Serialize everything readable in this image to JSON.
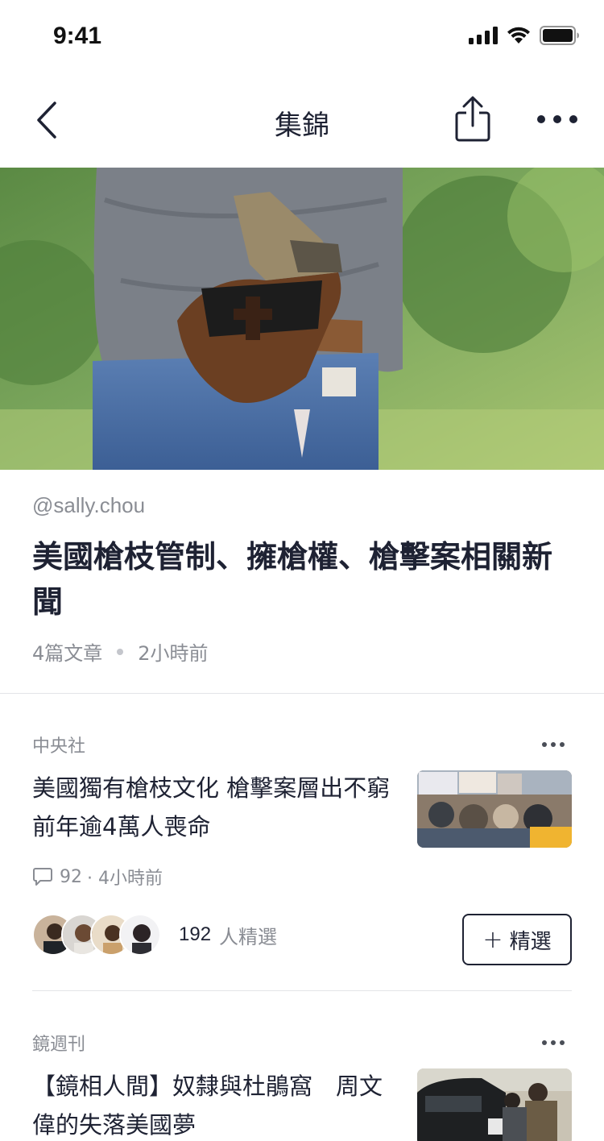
{
  "status": {
    "time": "9:41"
  },
  "nav": {
    "title": "集錦"
  },
  "collection": {
    "author": "@sally.chou",
    "title": "美國槍枝管制、擁槍權、槍擊案相關新聞",
    "article_count": "4篇文章",
    "updated": "2小時前"
  },
  "articles": [
    {
      "source": "中央社",
      "headline": "美國獨有槍枝文化 槍擊案層出不窮前年逾4萬人喪命",
      "comments": "92",
      "time": "· 4小時前",
      "curator_count": "192",
      "curator_label": "人精選",
      "pick_label": "精選"
    },
    {
      "source": "鏡週刊",
      "headline": "【鏡相人間】奴隸與杜鵑窩　周文偉的失落美國夢"
    }
  ],
  "icons": {
    "back": "chevron-left-icon",
    "share": "share-icon",
    "more": "more-horizontal-icon",
    "comment": "comment-icon",
    "plus": "plus-icon"
  },
  "colors": {
    "text_primary": "#1e2233",
    "text_secondary": "#8a8d94",
    "divider": "#e3e4e8"
  }
}
